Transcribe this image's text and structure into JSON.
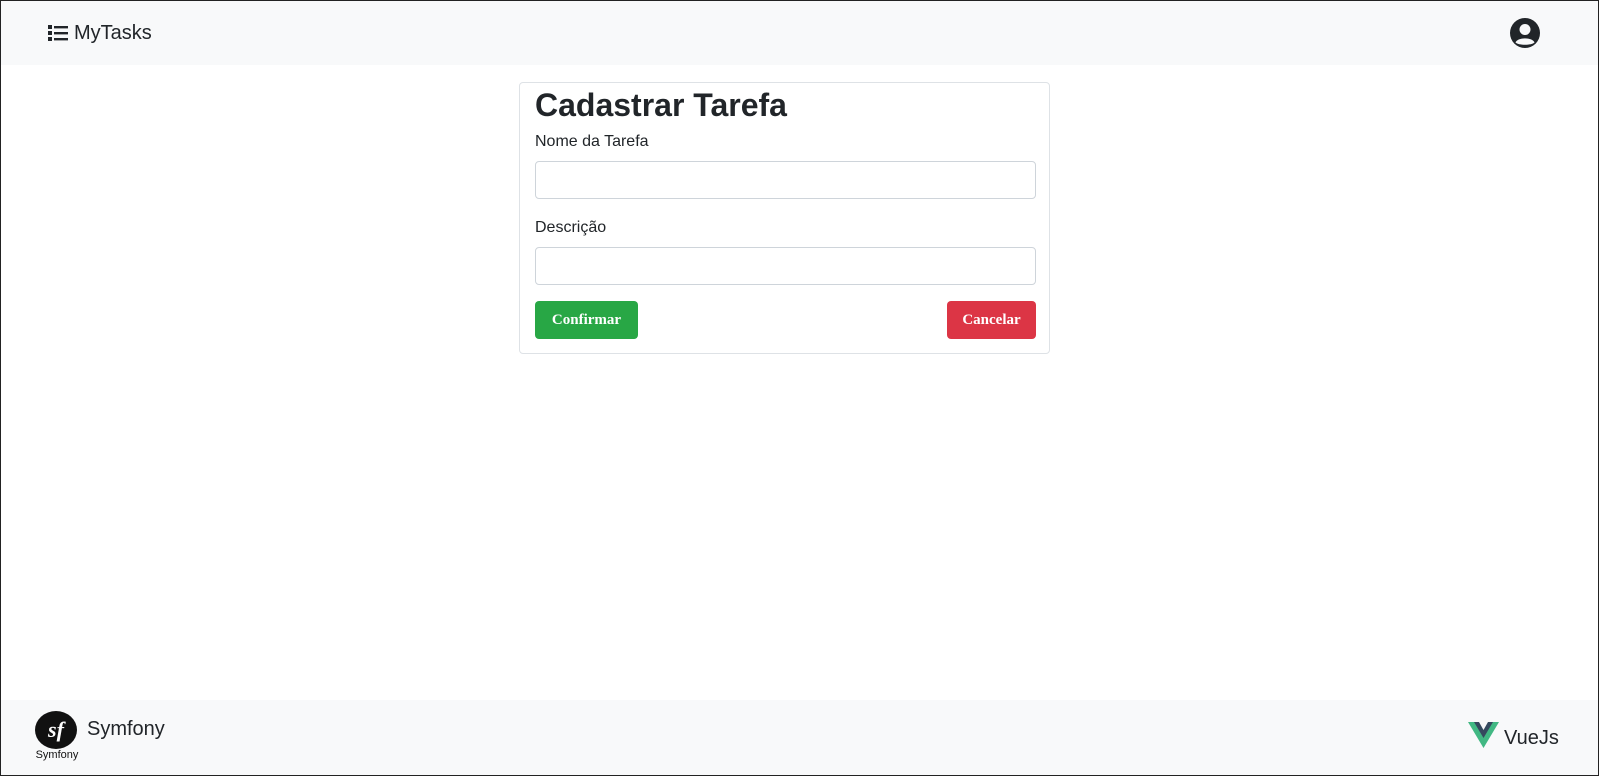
{
  "navbar": {
    "brand": "MyTasks",
    "brand_icon": "list-icon",
    "user_icon": "user-circle-icon"
  },
  "form": {
    "title": "Cadastrar Tarefa",
    "name_label": "Nome da Tarefa",
    "name_value": "",
    "description_label": "Descrição",
    "description_value": "",
    "confirm_label": "Confirmar",
    "cancel_label": "Cancelar"
  },
  "footer": {
    "left_logo_caption": "Symfony",
    "left_text": "Symfony",
    "right_text": "VueJs",
    "left_icon": "symfony-logo-icon",
    "right_icon": "vue-logo-icon"
  },
  "colors": {
    "navbar_bg": "#f8f9fa",
    "confirm_button": "#28a745",
    "cancel_button": "#dc3545",
    "vue_green": "#41b883",
    "vue_dark": "#35495e"
  }
}
